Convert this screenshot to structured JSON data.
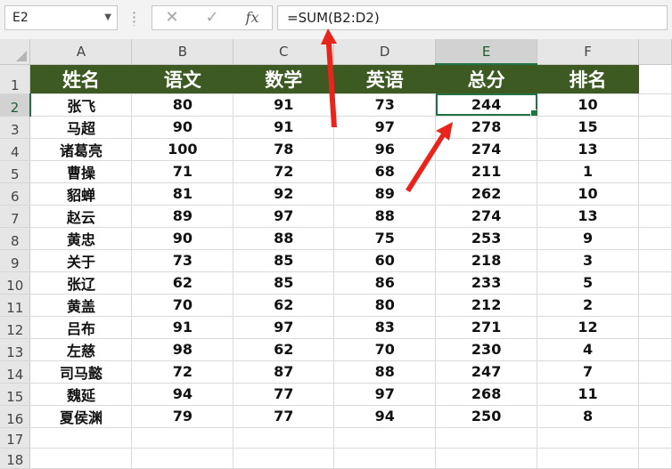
{
  "name_box": "E2",
  "formula": "=SUM(B2:D2)",
  "fx_label": "fx",
  "columns": [
    "A",
    "B",
    "C",
    "D",
    "E",
    "F"
  ],
  "active_column": "E",
  "active_row": "2",
  "rows": [
    "1",
    "2",
    "3",
    "4",
    "5",
    "6",
    "7",
    "8",
    "9",
    "10",
    "11",
    "12",
    "13",
    "14",
    "15",
    "16",
    "17",
    "18"
  ],
  "header": [
    "姓名",
    "语文",
    "数学",
    "英语",
    "总分",
    "排名"
  ],
  "data": [
    [
      "张飞",
      "80",
      "91",
      "73",
      "244",
      "10"
    ],
    [
      "马超",
      "90",
      "91",
      "97",
      "278",
      "15"
    ],
    [
      "诸葛亮",
      "100",
      "78",
      "96",
      "274",
      "13"
    ],
    [
      "曹操",
      "71",
      "72",
      "68",
      "211",
      "1"
    ],
    [
      "貂蝉",
      "81",
      "92",
      "89",
      "262",
      "10"
    ],
    [
      "赵云",
      "89",
      "97",
      "88",
      "274",
      "13"
    ],
    [
      "黄忠",
      "90",
      "88",
      "75",
      "253",
      "9"
    ],
    [
      "关于",
      "73",
      "85",
      "60",
      "218",
      "3"
    ],
    [
      "张辽",
      "62",
      "85",
      "86",
      "233",
      "5"
    ],
    [
      "黄盖",
      "70",
      "62",
      "80",
      "212",
      "2"
    ],
    [
      "吕布",
      "91",
      "97",
      "83",
      "271",
      "12"
    ],
    [
      "左慈",
      "98",
      "62",
      "70",
      "230",
      "4"
    ],
    [
      "司马懿",
      "72",
      "87",
      "88",
      "247",
      "7"
    ],
    [
      "魏延",
      "94",
      "77",
      "97",
      "268",
      "11"
    ],
    [
      "夏侯渊",
      "79",
      "77",
      "94",
      "250",
      "8"
    ]
  ],
  "colors": {
    "header_fill": "#3c5a22",
    "selection": "#217346",
    "annotation_arrow": "#e8251c"
  }
}
